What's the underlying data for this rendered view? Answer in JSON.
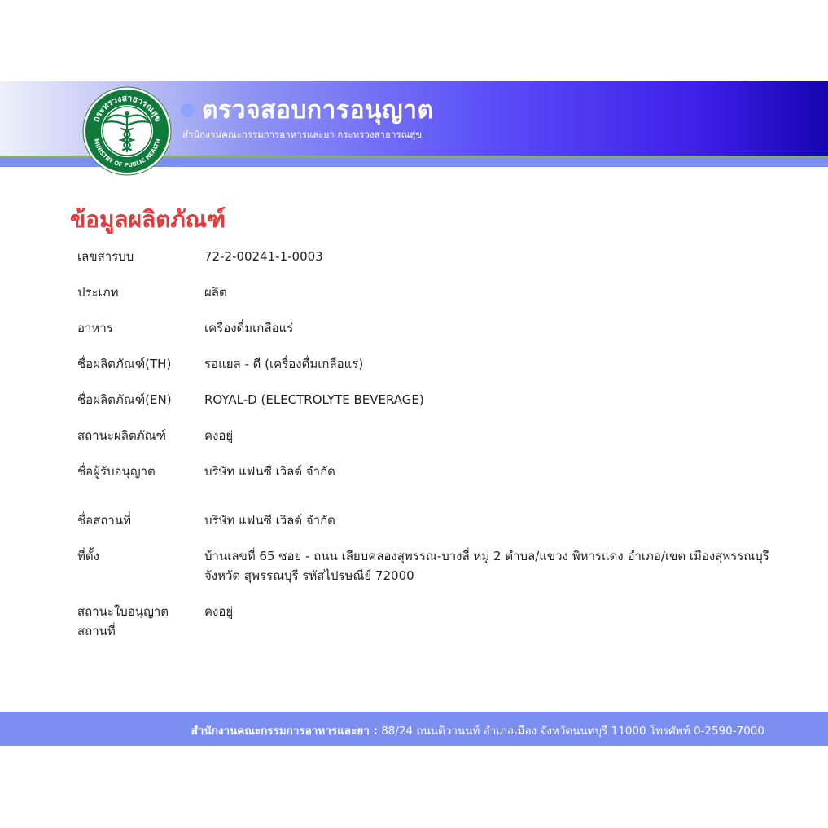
{
  "header": {
    "title": "ตรวจสอบการอนุญาต",
    "subtitle": "สำนักงานคณะกรรมการอาหารและยา กระทรวงสาธารณสุข",
    "logo": {
      "icon": "ministry-of-public-health-seal",
      "text_top": "กระทรวงสาธารณสุข",
      "text_bottom": "MINISTRY OF PUBLIC HEALTH"
    },
    "colors": {
      "gradient_end": "#1505b0",
      "accent_dot": "#8ea2ff"
    }
  },
  "main": {
    "heading": "ข้อมูลผลิตภัณฑ์",
    "heading_color": "#e7373a",
    "rows": [
      {
        "label": "เลขสารบบ",
        "value": "72-2-00241-1-0003"
      },
      {
        "label": "ประเภท",
        "value": "ผลิต"
      },
      {
        "label": "อาหาร",
        "value": "เครื่องดื่มเกลือแร่"
      },
      {
        "label": "ชื่อผลิตภัณฑ์(TH)",
        "value": "รอแยล - ดี (เครื่องดื่มเกลือแร่)"
      },
      {
        "label": "ชื่อผลิตภัณฑ์(EN)",
        "value": "ROYAL-D (ELECTROLYTE BEVERAGE)"
      },
      {
        "label": "สถานะผลิตภัณฑ์",
        "value": "คงอยู่"
      },
      {
        "label": "ชื่อผู้รับอนุญาต",
        "value": "บริษัท แฟนซี เวิลด์ จำกัด"
      },
      {
        "label": "ชื่อสถานที่",
        "value": "บริษัท แฟนซี เวิลด์ จำกัด"
      },
      {
        "label": "ที่ตั้ง",
        "value_line1": "บ้านเลขที่ 65 ซอย - ถนน เลียบคลองสุพรรณ-บางลี่ หมู่ 2 ตำบล/แขวง พิหารแดง อำเภอ/เขต เมืองสุพรรณบุรี",
        "value_line2": "จังหวัด สุพรรณบุรี รหัสไปรษณีย์ 72000"
      },
      {
        "label_line1": "สถานะใบอนุญาต",
        "label_line2": "สถานที่",
        "value": "คงอยู่"
      }
    ]
  },
  "footer": {
    "org": "สำนักงานคณะกรรมการอาหารและยา :",
    "address": " 88/24 ถนนติวานนท์ อำเภอเมือง จังหวัดนนทบุรี 11000 โทรศัพท์ 0-2590-7000"
  }
}
